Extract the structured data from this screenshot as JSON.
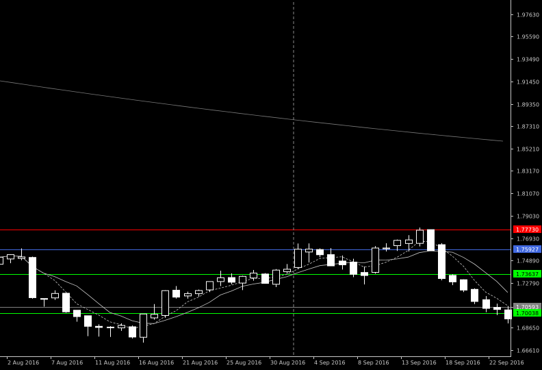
{
  "chart_data": {
    "type": "candlestick",
    "ylim": [
      1.6621,
      1.9763
    ],
    "y_ticks": [
      "1.97630",
      "1.95590",
      "1.93490",
      "1.91450",
      "1.89350",
      "1.87310",
      "1.85210",
      "1.83170",
      "1.81070",
      "1.79030",
      "1.76930",
      "1.74890",
      "1.72790",
      "1.70590",
      "1.68650",
      "1.66610"
    ],
    "x_labels": [
      "2 Aug 2016",
      "7 Aug 2016",
      "11 Aug 2016",
      "16 Aug 2016",
      "21 Aug 2016",
      "25 Aug 2016",
      "30 Aug 2016",
      "4 Sep 2016",
      "8 Sep 2016",
      "13 Sep 2016",
      "18 Sep 2016",
      "22 Sep 2016"
    ],
    "levels": [
      {
        "value": 1.7773,
        "label": "1.77730",
        "color": "#ff0000"
      },
      {
        "value": 1.75927,
        "label": "1.75927",
        "color": "#4169e1"
      },
      {
        "value": 1.73637,
        "label": "1.73637",
        "color": "#00ff00"
      },
      {
        "value": 1.70593,
        "label": "1.70593",
        "color": "#808080"
      },
      {
        "value": 1.70038,
        "label": "1.70038",
        "color": "#00ff00"
      }
    ],
    "candles": [
      {
        "o": 1.7453,
        "h": 1.7573,
        "l": 1.7393,
        "c": 1.7518
      },
      {
        "o": 1.7502,
        "h": 1.7544,
        "l": 1.7463,
        "c": 1.7542
      },
      {
        "o": 1.7507,
        "h": 1.76,
        "l": 1.749,
        "c": 1.7521
      },
      {
        "o": 1.7516,
        "h": 1.7524,
        "l": 1.7135,
        "c": 1.7144
      },
      {
        "o": 1.7136,
        "h": 1.7137,
        "l": 1.7061,
        "c": 1.7129
      },
      {
        "o": 1.7142,
        "h": 1.7212,
        "l": 1.7124,
        "c": 1.7183
      },
      {
        "o": 1.7185,
        "h": 1.7189,
        "l": 1.7004,
        "c": 1.7013
      },
      {
        "o": 1.7028,
        "h": 1.7029,
        "l": 1.6922,
        "c": 1.6969
      },
      {
        "o": 1.6977,
        "h": 1.6979,
        "l": 1.6788,
        "c": 1.6879
      },
      {
        "o": 1.6879,
        "h": 1.6897,
        "l": 1.6784,
        "c": 1.6869
      },
      {
        "o": 1.6871,
        "h": 1.6881,
        "l": 1.6781,
        "c": 1.6872
      },
      {
        "o": 1.6865,
        "h": 1.6907,
        "l": 1.6837,
        "c": 1.6887
      },
      {
        "o": 1.6875,
        "h": 1.6887,
        "l": 1.6767,
        "c": 1.678
      },
      {
        "o": 1.6778,
        "h": 1.6994,
        "l": 1.6729,
        "c": 1.6993
      },
      {
        "o": 1.6957,
        "h": 1.7085,
        "l": 1.6941,
        "c": 1.699
      },
      {
        "o": 1.6979,
        "h": 1.7213,
        "l": 1.6958,
        "c": 1.7209
      },
      {
        "o": 1.7213,
        "h": 1.7251,
        "l": 1.7136,
        "c": 1.7149
      },
      {
        "o": 1.716,
        "h": 1.72,
        "l": 1.7135,
        "c": 1.7181
      },
      {
        "o": 1.7181,
        "h": 1.7219,
        "l": 1.7155,
        "c": 1.721
      },
      {
        "o": 1.7216,
        "h": 1.7296,
        "l": 1.7196,
        "c": 1.7293
      },
      {
        "o": 1.7293,
        "h": 1.7393,
        "l": 1.7251,
        "c": 1.7328
      },
      {
        "o": 1.733,
        "h": 1.7369,
        "l": 1.7269,
        "c": 1.7287
      },
      {
        "o": 1.7279,
        "h": 1.7347,
        "l": 1.7214,
        "c": 1.7341
      },
      {
        "o": 1.7326,
        "h": 1.74,
        "l": 1.7301,
        "c": 1.7371
      },
      {
        "o": 1.7363,
        "h": 1.7371,
        "l": 1.728,
        "c": 1.7276
      },
      {
        "o": 1.7268,
        "h": 1.7408,
        "l": 1.7242,
        "c": 1.7399
      },
      {
        "o": 1.7384,
        "h": 1.7455,
        "l": 1.7365,
        "c": 1.7407
      },
      {
        "o": 1.7423,
        "h": 1.7645,
        "l": 1.741,
        "c": 1.7592
      },
      {
        "o": 1.7566,
        "h": 1.7646,
        "l": 1.7469,
        "c": 1.7593
      },
      {
        "o": 1.7589,
        "h": 1.76,
        "l": 1.7519,
        "c": 1.7541
      },
      {
        "o": 1.7542,
        "h": 1.7602,
        "l": 1.7437,
        "c": 1.7438
      },
      {
        "o": 1.7483,
        "h": 1.7534,
        "l": 1.7404,
        "c": 1.7448
      },
      {
        "o": 1.7473,
        "h": 1.7504,
        "l": 1.7334,
        "c": 1.736
      },
      {
        "o": 1.7377,
        "h": 1.7432,
        "l": 1.7266,
        "c": 1.7349
      },
      {
        "o": 1.7378,
        "h": 1.7621,
        "l": 1.7366,
        "c": 1.7603
      },
      {
        "o": 1.7596,
        "h": 1.7647,
        "l": 1.7571,
        "c": 1.7603
      },
      {
        "o": 1.7625,
        "h": 1.7681,
        "l": 1.7576,
        "c": 1.7674
      },
      {
        "o": 1.7645,
        "h": 1.7722,
        "l": 1.7571,
        "c": 1.7678
      },
      {
        "o": 1.7646,
        "h": 1.7792,
        "l": 1.7618,
        "c": 1.7768
      },
      {
        "o": 1.7773,
        "h": 1.7773,
        "l": 1.7576,
        "c": 1.7579
      },
      {
        "o": 1.7634,
        "h": 1.7648,
        "l": 1.7304,
        "c": 1.7321
      },
      {
        "o": 1.735,
        "h": 1.736,
        "l": 1.726,
        "c": 1.729
      },
      {
        "o": 1.731,
        "h": 1.7314,
        "l": 1.7196,
        "c": 1.7214
      },
      {
        "o": 1.7221,
        "h": 1.723,
        "l": 1.7085,
        "c": 1.7109
      },
      {
        "o": 1.7125,
        "h": 1.7159,
        "l": 1.701,
        "c": 1.7045
      },
      {
        "o": 1.7054,
        "h": 1.7089,
        "l": 1.6983,
        "c": 1.7035
      },
      {
        "o": 1.7031,
        "h": 1.7067,
        "l": 1.6906,
        "c": 1.6948
      }
    ]
  }
}
